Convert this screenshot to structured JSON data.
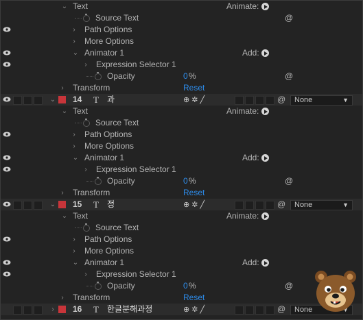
{
  "labels": {
    "text": "Text",
    "animate": "Animate:",
    "source_text": "Source Text",
    "path_options": "Path Options",
    "more_options": "More Options",
    "animator": "Animator 1",
    "add": "Add:",
    "expression_selector": "Expression Selector 1",
    "opacity": "Opacity",
    "transform": "Transform",
    "reset": "Reset",
    "T": "T"
  },
  "groups": [
    {
      "opacity_value": "0",
      "opacity_unit": "%"
    },
    {
      "opacity_value": "0",
      "opacity_unit": "%"
    },
    {
      "opacity_value": "0",
      "opacity_unit": "%"
    }
  ],
  "layers": [
    {
      "number": "14",
      "name": "과",
      "mode": "None"
    },
    {
      "number": "15",
      "name": "정",
      "mode": "None"
    },
    {
      "number": "16",
      "name": "한글분해과정",
      "mode": "None"
    }
  ],
  "colors": {
    "label_red": "#c8353a",
    "link_blue": "#2d8ceb",
    "panel_bg": "#232323",
    "layer_row_bg": "#2c2c2c"
  }
}
